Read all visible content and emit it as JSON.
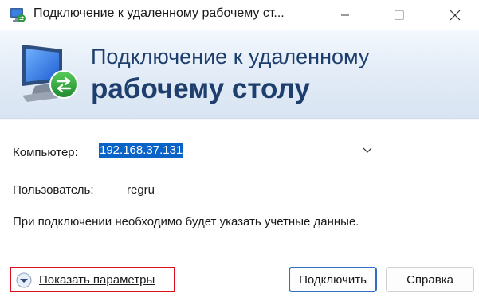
{
  "window": {
    "title": "Подключение к удаленному рабочему ст..."
  },
  "banner": {
    "line1": "Подключение к удаленному",
    "line2": "рабочему столу"
  },
  "form": {
    "computer_label": "Компьютер:",
    "computer_value": "192.168.37.131",
    "user_label": "Пользователь:",
    "user_value": "regru",
    "info_text": "При подключении необходимо будет указать учетные данные."
  },
  "footer": {
    "show_options_label": "Показать параметры",
    "connect_label": "Подключить",
    "help_label": "Справка"
  },
  "colors": {
    "banner_text": "#1e3f6d",
    "selection": "#0a64c8",
    "highlight_box": "#d90f1e",
    "default_button_border": "#2e6fc2"
  }
}
